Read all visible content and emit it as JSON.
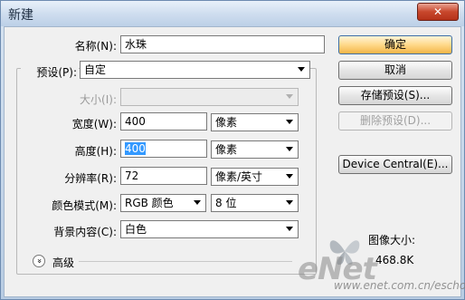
{
  "window": {
    "title": "新建",
    "close_glyph": "✕"
  },
  "form": {
    "name": {
      "label": "名称(N):",
      "value": "水珠"
    },
    "preset": {
      "label": "预设(P):",
      "value": "自定"
    },
    "size": {
      "label": "大小(I):",
      "value": ""
    },
    "width": {
      "label": "宽度(W):",
      "value": "400",
      "unit": "像素"
    },
    "height": {
      "label": "高度(H):",
      "value": "400",
      "unit": "像素"
    },
    "resolution": {
      "label": "分辨率(R):",
      "value": "72",
      "unit": "像素/英寸"
    },
    "color_mode": {
      "label": "颜色模式(M):",
      "value": "RGB 颜色",
      "depth": "8 位"
    },
    "background": {
      "label": "背景内容(C):",
      "value": "白色"
    },
    "advanced": {
      "label": "高级",
      "toggle_glyph": "»"
    }
  },
  "buttons": {
    "ok": "确定",
    "cancel": "取消",
    "save_preset": "存储预设(S)...",
    "delete_preset": "删除预设(D)...",
    "device_central": "Device Central(E)..."
  },
  "image_size": {
    "label": "图像大小:",
    "value": "468.8K"
  },
  "watermark": {
    "brand": "eNet",
    "url": "www.enet.com.cn/eschool"
  }
}
